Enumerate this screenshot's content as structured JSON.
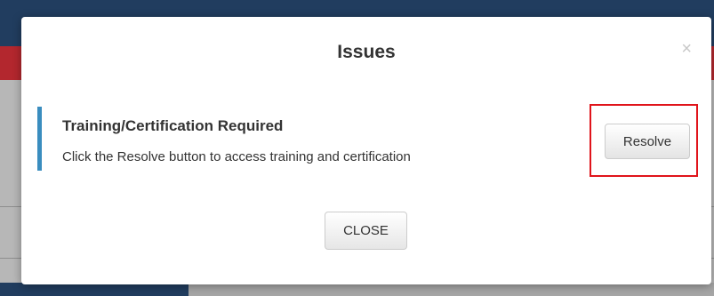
{
  "modal": {
    "title": "Issues",
    "close_icon": "×",
    "issue": {
      "title": "Training/Certification Required",
      "description": "Click the Resolve button to access training and certification"
    },
    "resolve_label": "Resolve",
    "close_label": "CLOSE"
  },
  "colors": {
    "header_navy": "#213d5f",
    "header_red": "#b3272e",
    "issue_accent": "#3a8dbf",
    "highlight_red": "#e0141b"
  },
  "icons": {
    "close": "close-icon"
  }
}
